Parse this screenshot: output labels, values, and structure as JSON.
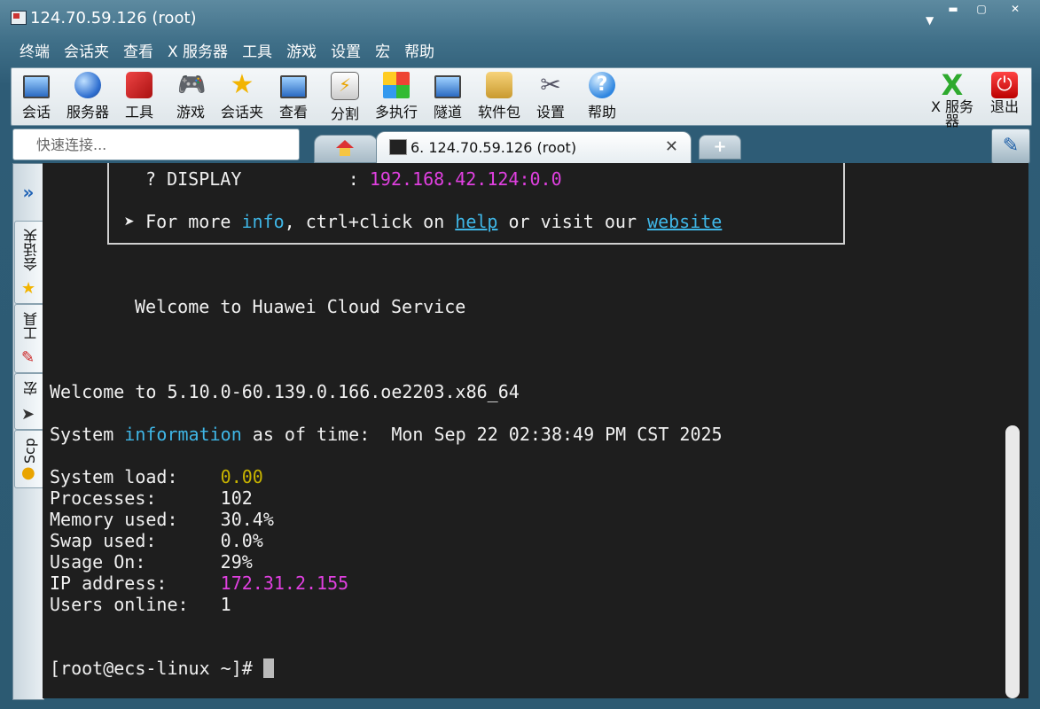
{
  "window": {
    "title": "124.70.59.126 (root)"
  },
  "menubar": [
    "终端",
    "会话夹",
    "查看",
    "X 服务器",
    "工具",
    "游戏",
    "设置",
    "宏",
    "帮助"
  ],
  "toolbar": {
    "items": [
      {
        "label": "会话",
        "icon": "session-monitor-icon"
      },
      {
        "label": "服务器",
        "icon": "servers-globe-icon"
      },
      {
        "label": "工具",
        "icon": "tools-icon"
      },
      {
        "label": "游戏",
        "icon": "games-icon"
      },
      {
        "label": "会话夹",
        "icon": "star-icon"
      },
      {
        "label": "查看",
        "icon": "view-icon"
      },
      {
        "label": "分割",
        "icon": "split-icon"
      },
      {
        "label": "多执行",
        "icon": "multiexec-icon"
      },
      {
        "label": "隧道",
        "icon": "tunneling-icon"
      },
      {
        "label": "软件包",
        "icon": "packages-icon"
      },
      {
        "label": "设置",
        "icon": "settings-icon"
      },
      {
        "label": "帮助",
        "icon": "help-icon"
      }
    ],
    "xserver": {
      "label": "X 服务器",
      "icon": "x-server-icon"
    },
    "exit": {
      "label": "退出",
      "icon": "power-icon"
    }
  },
  "quick_connect": {
    "placeholder": "快速连接..."
  },
  "tabs": {
    "active_label": "6. 124.70.59.126 (root)"
  },
  "sidebar": {
    "tabs": [
      "会话夹",
      "工具",
      "宏",
      "Scp"
    ]
  },
  "terminal": {
    "display_label": "? DISPLAY          : ",
    "display_value": "192.168.42.124:0.0",
    "more_prefix": "➤ For more ",
    "more_info": "info",
    "more_mid": ", ctrl+click on ",
    "more_help": "help",
    "more_mid2": " or visit our ",
    "more_website": "website",
    "welcome_huawei": "Welcome to Huawei Cloud Service",
    "welcome_kernel": "Welcome to 5.10.0-60.139.0.166.oe2203.x86_64",
    "sysinfo_prefix": "System ",
    "sysinfo_word": "information",
    "sysinfo_suffix": " as of time:  Mon Sep 22 02:38:49 PM CST 2025",
    "stats": [
      {
        "label": "System load:    ",
        "value": "0.00",
        "color": "yellow"
      },
      {
        "label": "Processes:      ",
        "value": "102",
        "color": "default"
      },
      {
        "label": "Memory used:    ",
        "value": "30.4%",
        "color": "default"
      },
      {
        "label": "Swap used:      ",
        "value": "0.0%",
        "color": "default"
      },
      {
        "label": "Usage On:       ",
        "value": "29%",
        "color": "default"
      },
      {
        "label": "IP address:     ",
        "value": "172.31.2.155",
        "color": "magenta"
      },
      {
        "label": "Users online:   ",
        "value": "1",
        "color": "default"
      }
    ],
    "prompt": "[root@ecs-linux ~]# "
  },
  "colors": {
    "terminal_bg": "#1e1e1e",
    "magenta": "#e040e0",
    "yellow": "#c8b400",
    "cyan": "#3fb6e6"
  }
}
